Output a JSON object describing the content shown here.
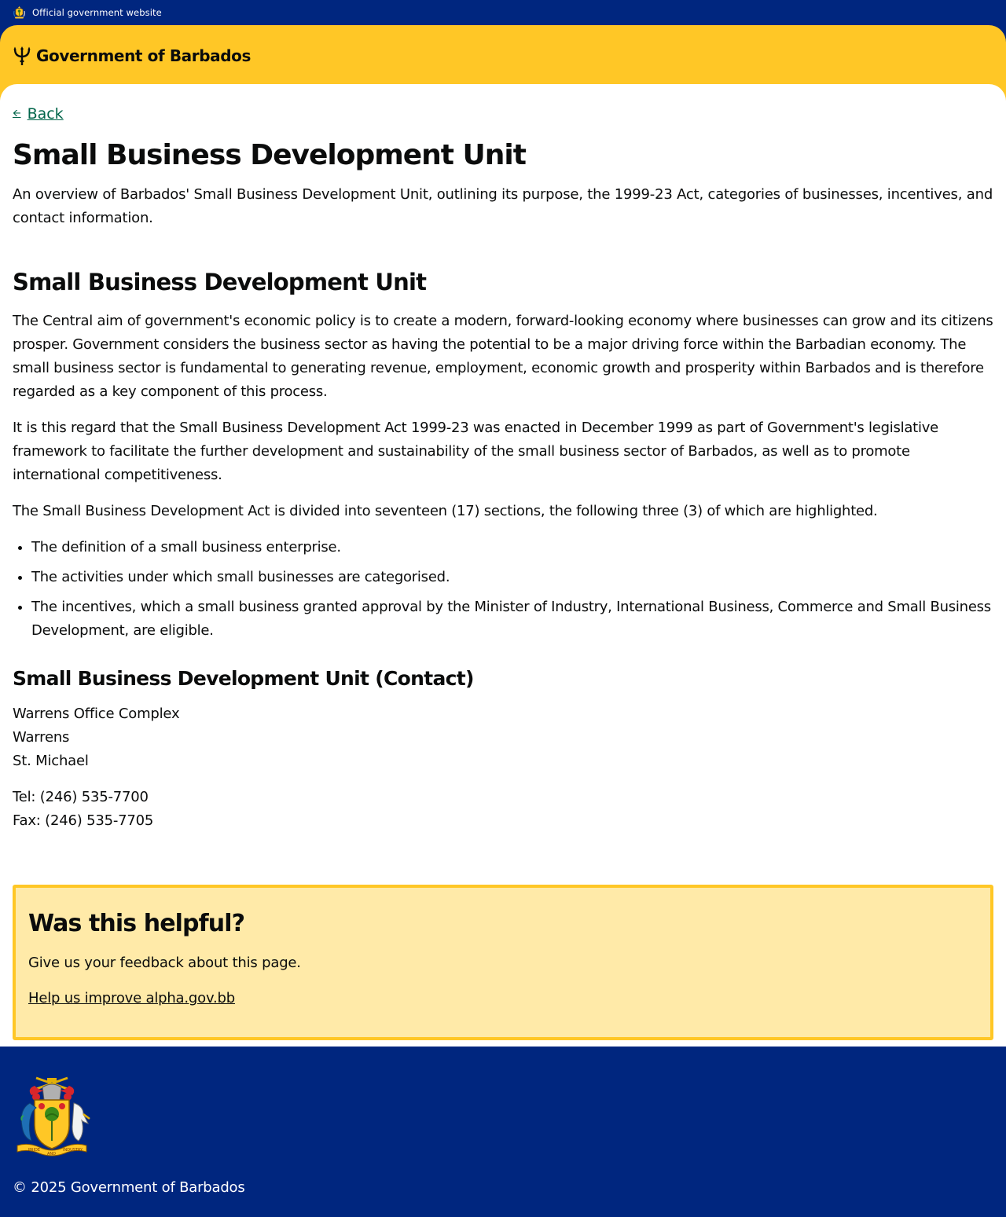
{
  "topbar": {
    "official_text": "Official government website",
    "crest_icon": "barbados-coat-of-arms-icon"
  },
  "header": {
    "brand": "Government of Barbados",
    "logo_icon": "trident-icon",
    "background_color": "#ffc726"
  },
  "nav": {
    "back_label": "Back",
    "back_icon": "arrow-left-icon"
  },
  "page": {
    "title": "Small Business Development Unit",
    "lead": "An overview of Barbados' Small Business Development Unit, outlining its purpose, the 1999-23 Act, categories of businesses, incentives, and contact information."
  },
  "section": {
    "heading": "Small Business Development Unit",
    "paragraphs": [
      "The Central aim of government's economic policy is to create a modern, forward-looking economy where businesses can grow and its citizens prosper. Government considers the business sector as having the potential to be a major driving force within the Barbadian economy. The small business sector is fundamental to generating revenue, employment, economic growth and prosperity within Barbados and is therefore regarded as a key component of this process.",
      "It is this regard that the Small Business Development Act 1999-23 was enacted in December 1999 as part of Government's legislative framework to facilitate the further development and sustainability of the small business sector of Barbados, as well as to promote international competitiveness.",
      "The Small Business Development Act is divided into seventeen (17) sections, the following three (3) of which are highlighted."
    ],
    "bullets": [
      "The definition of a small business enterprise.",
      "The activities under which small businesses are categorised.",
      "The incentives, which a small business granted approval by the Minister of Industry, International Business, Commerce and Small Business Development, are eligible."
    ]
  },
  "contact": {
    "heading": "Small Business Development Unit (Contact)",
    "address": [
      "Warrens Office Complex",
      "Warrens",
      "St. Michael"
    ],
    "tel": "Tel: (246) 535-7700",
    "fax": "Fax: (246) 535-7705"
  },
  "feedback": {
    "heading": "Was this helpful?",
    "text": "Give us your feedback about this page.",
    "link": "Help us improve alpha.gov.bb",
    "background_color": "#ffeaa8",
    "border_color": "#ffc726"
  },
  "footer": {
    "crest_icon": "barbados-coat-of-arms-icon",
    "crest_motto": [
      "PRIDE",
      "AND",
      "INDUSTRY"
    ],
    "copyright": "© 2025 Government of Barbados",
    "background_color": "#00267f"
  }
}
